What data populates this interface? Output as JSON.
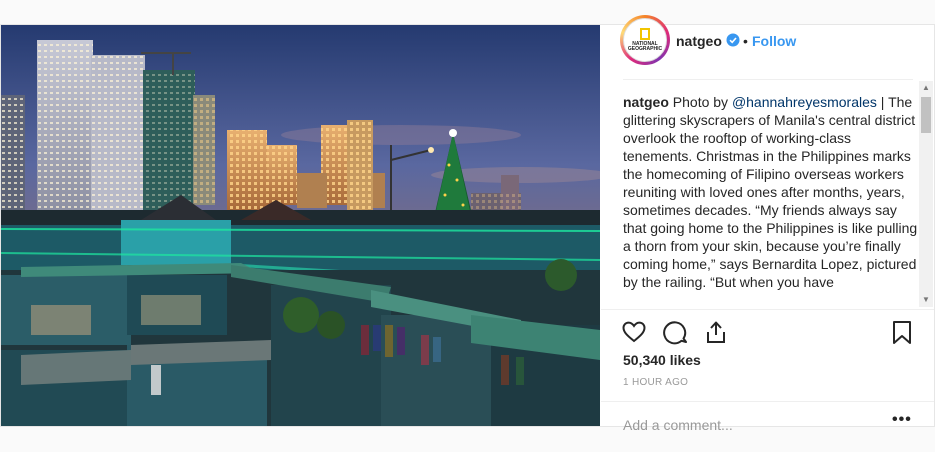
{
  "post": {
    "username": "natgeo",
    "separator": "•",
    "follow_label": "Follow",
    "avatar_text": "NATIONAL GEOGRAPHIC",
    "caption": {
      "username": "natgeo",
      "intro": " Photo by ",
      "mention": "@hannahreyesmorales",
      "body": " | The glittering skyscrapers of Manila's central district overlook the rooftop of working-class tenements. Christmas in the Philippines marks the homecoming of Filipino overseas workers reuniting with loved ones after months, years, sometimes decades. “My friends always say that going home to the Philippines is like pulling a thorn from your skin, because you’re finally coming home,” says Bernardita Lopez, pictured by the railing. “But when you have"
    },
    "likes": "50,340 likes",
    "time": "1 HOUR AGO",
    "comment_placeholder": "Add a comment...",
    "more_label": "•••"
  },
  "colors": {
    "accent": "#3897f0",
    "verified": "#3897f0",
    "neon": "#1ee8a0"
  },
  "icons": [
    "heart-icon",
    "comment-icon",
    "share-icon",
    "bookmark-icon",
    "verified-badge-icon"
  ]
}
